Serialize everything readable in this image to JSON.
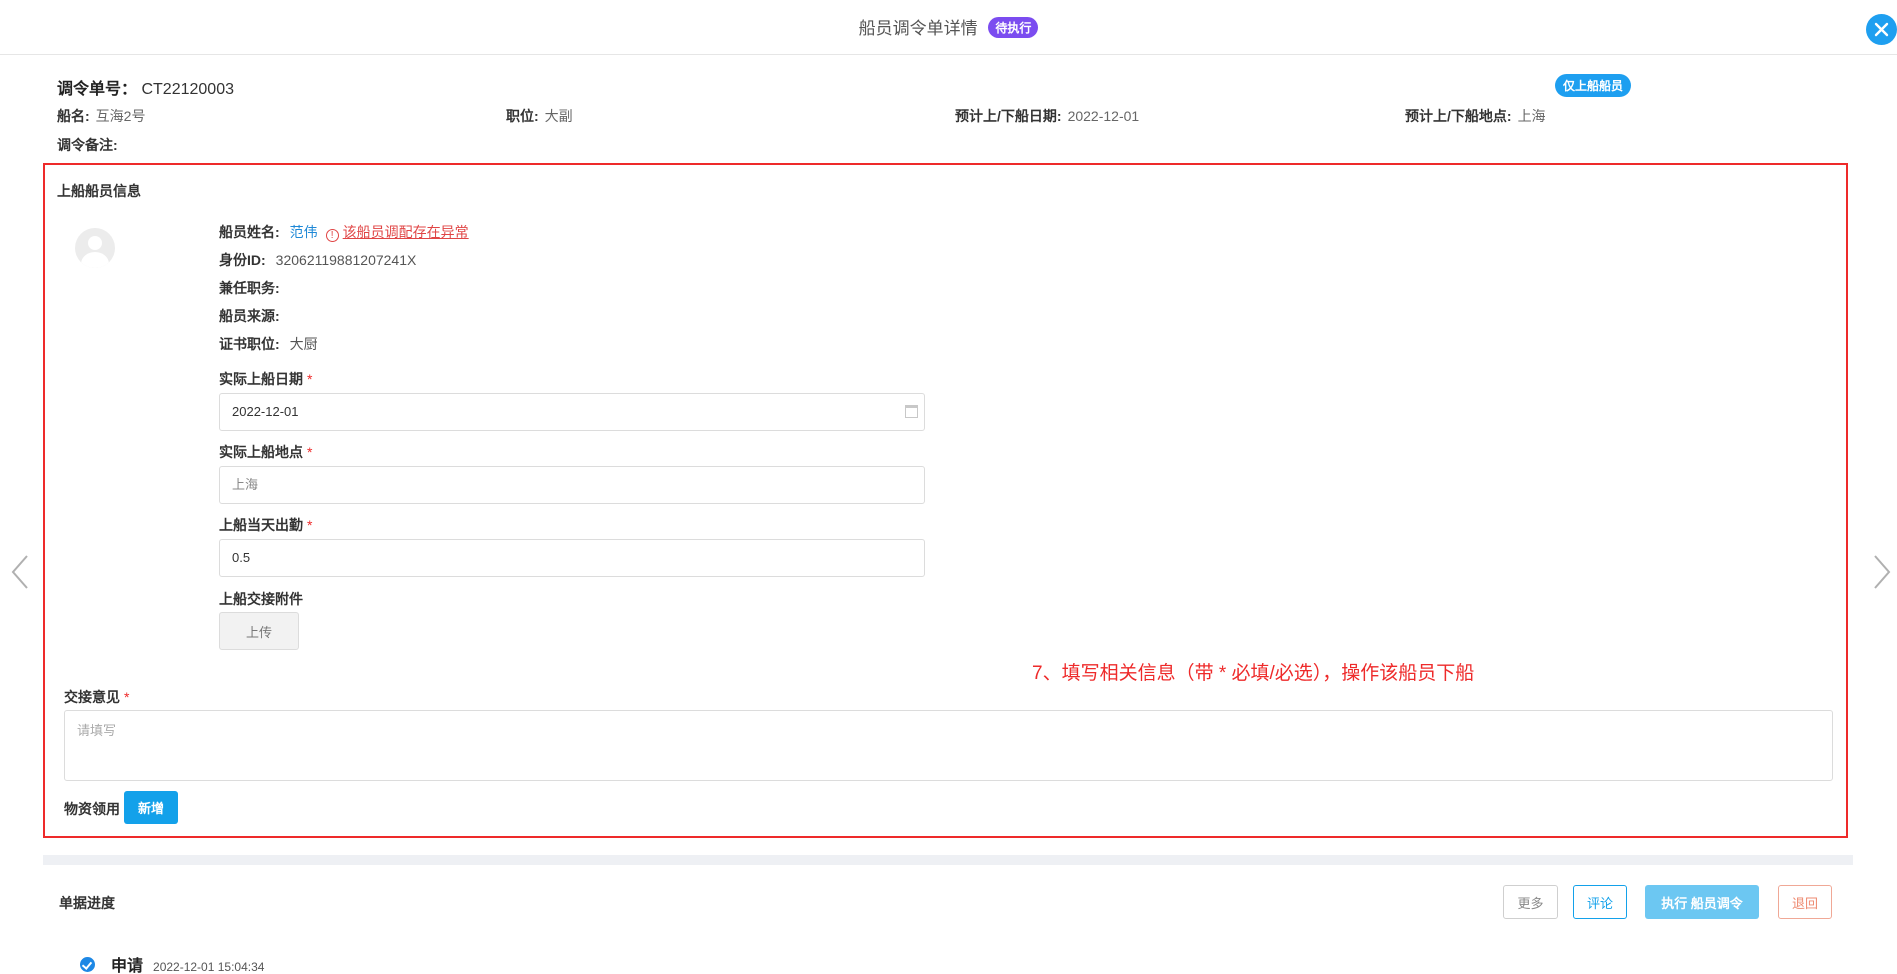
{
  "header": {
    "title": "船员调令单详情",
    "status_badge": "待执行"
  },
  "order": {
    "number_label": "调令单号：",
    "number": "CT22120003",
    "crew_only_badge": "仅上船船员"
  },
  "meta": {
    "ship_label": "船名:",
    "ship": "互海2号",
    "position_label": "职位:",
    "position": "大副",
    "date_label": "预计上/下船日期:",
    "date": "2022-12-01",
    "place_label": "预计上/下船地点:",
    "place": "上海",
    "note_label": "调令备注:"
  },
  "boarding": {
    "section_title": "上船船员信息",
    "crew_name_label": "船员姓名:",
    "crew_name": "范伟",
    "warning_text": "该船员调配存在异常",
    "id_label": "身份ID:",
    "id_value": "32062119881207241X",
    "concurrent_label": "兼任职务:",
    "source_label": "船员来源:",
    "cert_label": "证书职位:",
    "cert_value": "大厨",
    "actual_date_label": "实际上船日期",
    "actual_date_value": "2022-12-01",
    "actual_place_label": "实际上船地点",
    "actual_place_value": "上海",
    "attendance_label": "上船当天出勤",
    "attendance_value": "0.5",
    "attachment_label": "上船交接附件",
    "upload_button": "上传",
    "required_mark": "*"
  },
  "annotation": "7、填写相关信息（带 * 必填/必选），操作该船员下船",
  "handover": {
    "opinion_label": "交接意见",
    "opinion_placeholder": "请填写",
    "supplies_label": "物资领用",
    "add_button": "新增"
  },
  "progress": {
    "title": "单据进度",
    "more_button": "更多",
    "comment_button": "评论",
    "execute_button": "执行 船员调令",
    "return_button": "退回",
    "steps": [
      {
        "name": "申请",
        "time": "2022-12-01 15:04:34"
      }
    ]
  }
}
